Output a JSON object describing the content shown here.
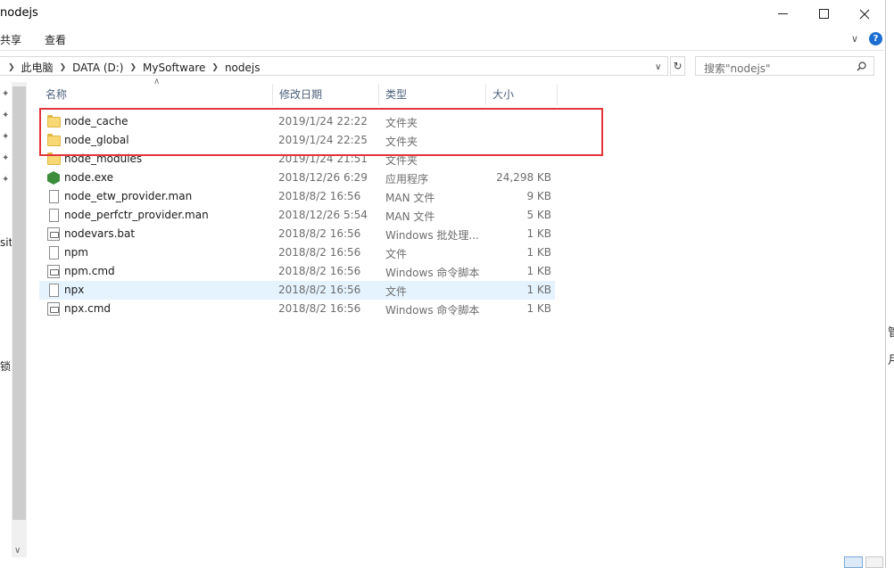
{
  "window": {
    "title": "nodejs"
  },
  "ribbon": {
    "tabs": [
      "共享",
      "查看"
    ]
  },
  "address": {
    "crumbs": [
      "此电脑",
      "DATA (D:)",
      "MySoftware",
      "nodejs"
    ]
  },
  "search": {
    "placeholder": "搜索\"nodejs\""
  },
  "nav": {
    "partial_items": [
      "sito",
      "锁"
    ]
  },
  "columns": {
    "name": "名称",
    "date": "修改日期",
    "type": "类型",
    "size": "大小"
  },
  "files": [
    {
      "name": "node_cache",
      "date": "2019/1/24 22:22",
      "type": "文件夹",
      "size": "",
      "icon": "folder-icon"
    },
    {
      "name": "node_global",
      "date": "2019/1/24 22:25",
      "type": "文件夹",
      "size": "",
      "icon": "folder-icon"
    },
    {
      "name": "node_modules",
      "date": "2019/1/24 21:51",
      "type": "文件夹",
      "size": "",
      "icon": "folder-icon"
    },
    {
      "name": "node.exe",
      "date": "2018/12/26 6:29",
      "type": "应用程序",
      "size": "24,298 KB",
      "icon": "node-exe-icon"
    },
    {
      "name": "node_etw_provider.man",
      "date": "2018/8/2 16:56",
      "type": "MAN 文件",
      "size": "9 KB",
      "icon": "file-icon"
    },
    {
      "name": "node_perfctr_provider.man",
      "date": "2018/12/26 5:54",
      "type": "MAN 文件",
      "size": "5 KB",
      "icon": "file-icon"
    },
    {
      "name": "nodevars.bat",
      "date": "2018/8/2 16:56",
      "type": "Windows 批处理...",
      "size": "1 KB",
      "icon": "batch-file-icon"
    },
    {
      "name": "npm",
      "date": "2018/8/2 16:56",
      "type": "文件",
      "size": "1 KB",
      "icon": "file-icon"
    },
    {
      "name": "npm.cmd",
      "date": "2018/8/2 16:56",
      "type": "Windows 命令脚本",
      "size": "1 KB",
      "icon": "batch-file-icon"
    },
    {
      "name": "npx",
      "date": "2018/8/2 16:56",
      "type": "文件",
      "size": "1 KB",
      "icon": "file-icon",
      "highlighted": true
    },
    {
      "name": "npx.cmd",
      "date": "2018/8/2 16:56",
      "type": "Windows 命令脚本",
      "size": "1 KB",
      "icon": "batch-file-icon"
    }
  ],
  "outside_chars": [
    "管",
    "月"
  ],
  "colors": {
    "annotation": "#e3353a",
    "selection": "#e5f3ff",
    "folder": "#f8d775"
  }
}
